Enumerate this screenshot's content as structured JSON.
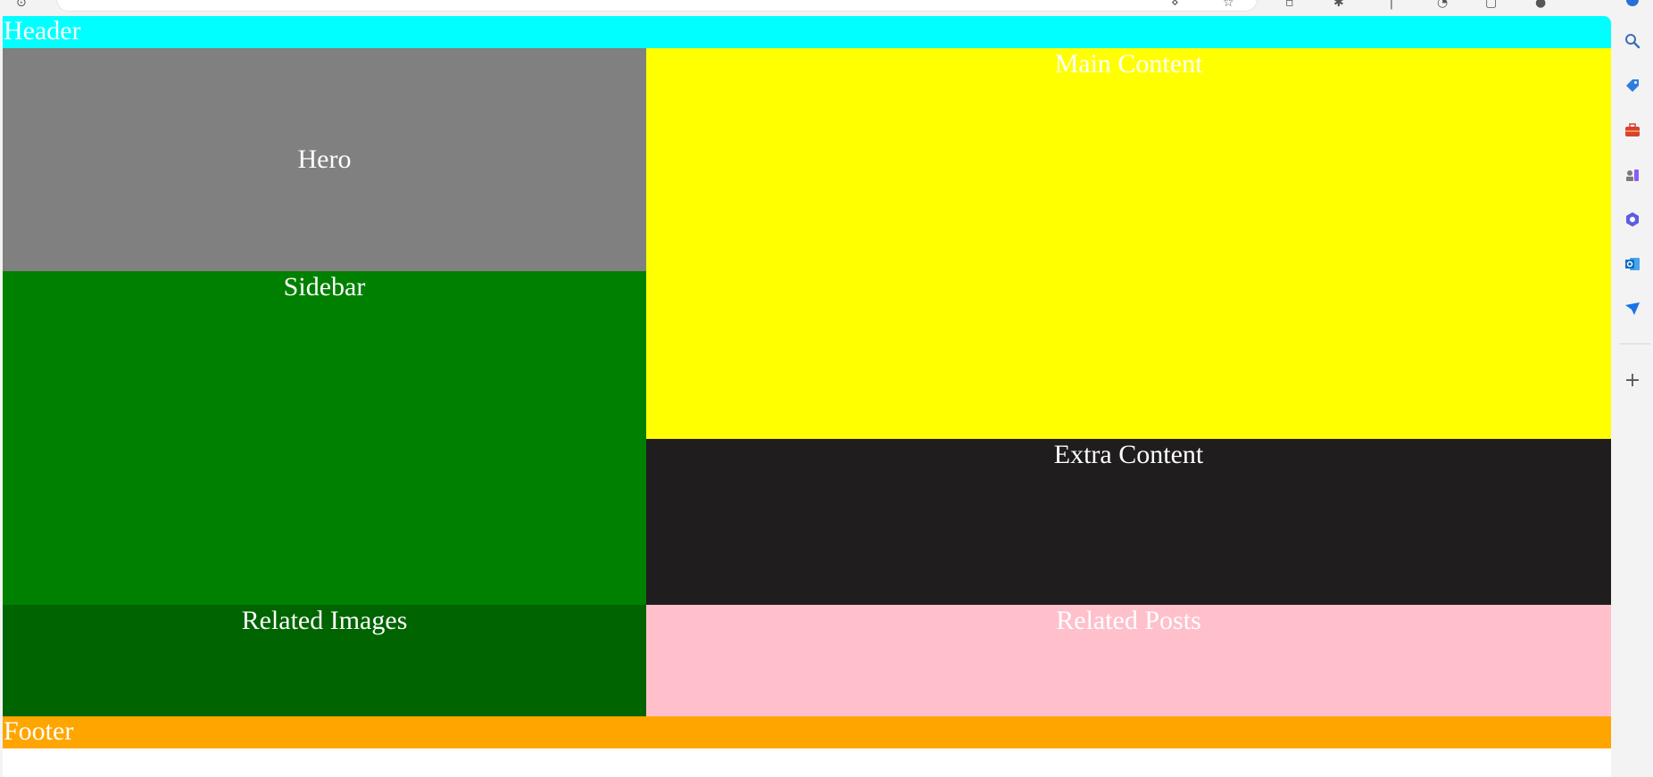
{
  "layout": {
    "header": "Header",
    "hero": "Hero",
    "sidebar": "Sidebar",
    "main_content": "Main Content",
    "extra_content": "Extra Content",
    "related_images": "Related Images",
    "related_posts": "Related Posts",
    "footer": "Footer"
  },
  "colors": {
    "header": "#00ffff",
    "hero": "#808080",
    "sidebar": "#008000",
    "main_content": "#ffff00",
    "extra_content": "#1f1d1e",
    "related_images": "#006400",
    "related_posts": "#ffc0cb",
    "footer": "#ffa500"
  },
  "sidebar_rail": {
    "icons": [
      "search-icon",
      "tag-icon",
      "toolbox-icon",
      "chess-icon",
      "copilot-icon",
      "outlook-icon",
      "send-icon"
    ],
    "add_button": "+"
  }
}
